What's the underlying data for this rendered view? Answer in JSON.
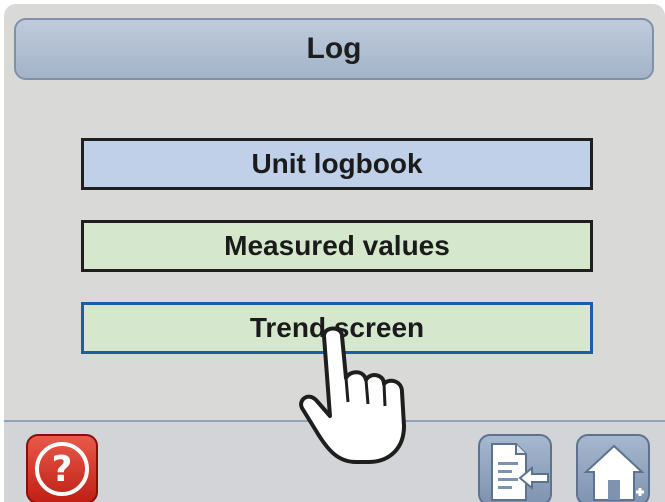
{
  "header": {
    "title": "Log"
  },
  "menu": {
    "items": [
      {
        "label": "Unit logbook"
      },
      {
        "label": "Measured values"
      },
      {
        "label": "Trend screen"
      }
    ]
  },
  "footer": {
    "help_symbol": "?",
    "icons": [
      "help-icon",
      "export-icon",
      "home-icon"
    ]
  },
  "colors": {
    "title_bar": "#a3b3c8",
    "logbook_button": "#c0d0e8",
    "value_button": "#d5e8cd",
    "selected_border": "#1a5ea8",
    "help_button": "#c01f14"
  }
}
